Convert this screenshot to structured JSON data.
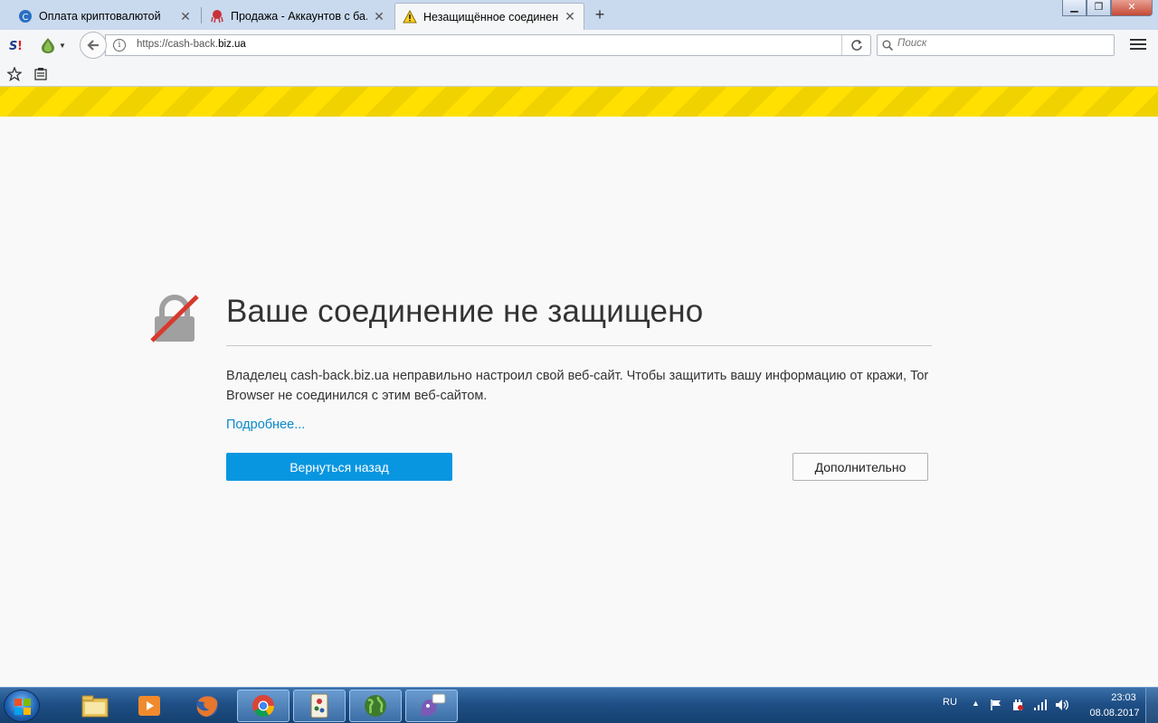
{
  "tabs": [
    {
      "title": "Оплата криптовалютой"
    },
    {
      "title": "Продажа - Аккаунтов с ба..."
    },
    {
      "title": "Незащищённое соединен...",
      "selected": true
    }
  ],
  "url": {
    "prefix": "https://cash-back.",
    "domain": "biz.ua"
  },
  "search": {
    "placeholder": "Поиск"
  },
  "error": {
    "title": "Ваше соединение не защищено",
    "description": "Владелец cash-back.biz.ua неправильно настроил свой веб-сайт. Чтобы защитить вашу информацию от кражи, Tor Browser не соединился с этим веб-сайтом.",
    "more_link": "Подробнее...",
    "back_label": "Вернуться назад",
    "advanced_label": "Дополнительно"
  },
  "taskbar": {
    "lang": "RU",
    "time": "23:03",
    "date": "08.08.2017"
  },
  "colors": {
    "accent": "#0996e0",
    "link": "#0a8ac8",
    "stripe_a": "#f0d200",
    "stripe_b": "#ffe000"
  }
}
